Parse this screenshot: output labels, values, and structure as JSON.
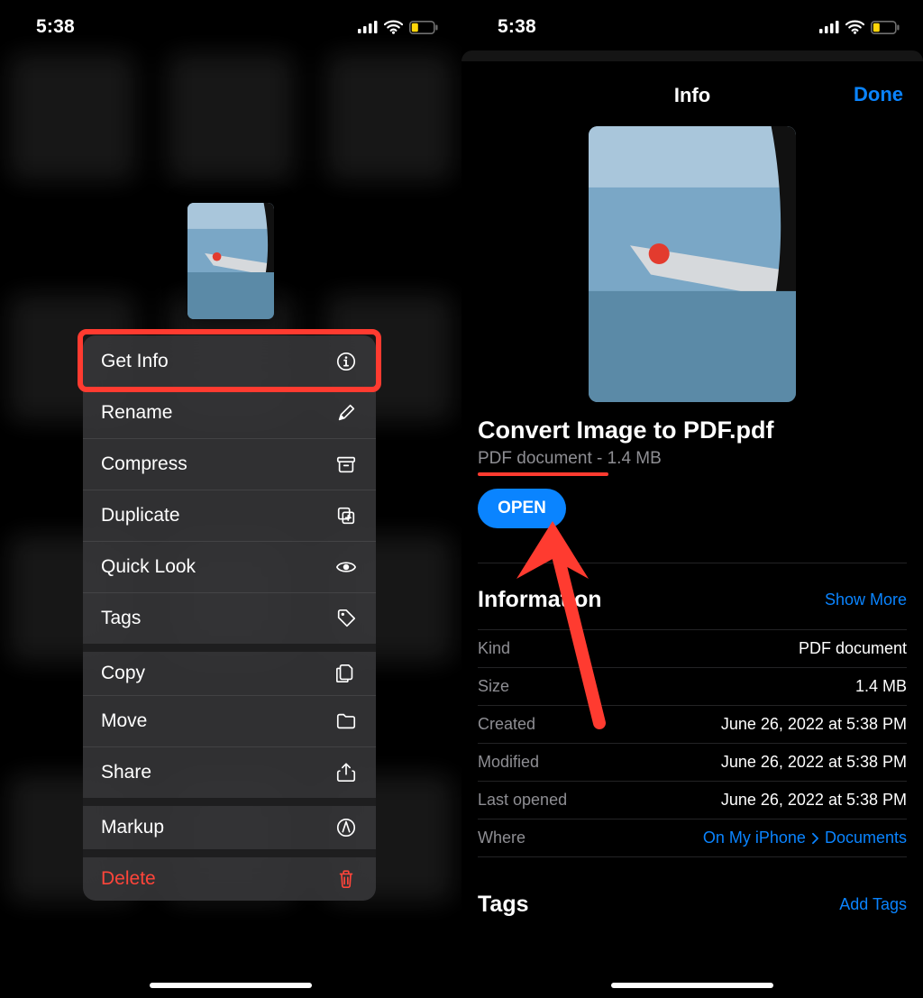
{
  "status": {
    "time": "5:38"
  },
  "contextMenu": {
    "items": [
      {
        "label": "Get Info",
        "icon": "info-icon",
        "highlight": true
      },
      {
        "label": "Rename",
        "icon": "pencil-icon"
      },
      {
        "label": "Compress",
        "icon": "archivebox-icon"
      },
      {
        "label": "Duplicate",
        "icon": "duplicate-icon"
      },
      {
        "label": "Quick Look",
        "icon": "eye-icon"
      },
      {
        "label": "Tags",
        "icon": "tag-icon"
      },
      {
        "label": "Copy",
        "icon": "copydoc-icon",
        "sepBig": true
      },
      {
        "label": "Move",
        "icon": "folder-icon"
      },
      {
        "label": "Share",
        "icon": "share-icon"
      },
      {
        "label": "Markup",
        "icon": "markup-icon",
        "sepBig": true
      },
      {
        "label": "Delete",
        "icon": "trash-icon",
        "destructive": true,
        "sepBig": true
      }
    ]
  },
  "infoSheet": {
    "title": "Info",
    "done": "Done",
    "file_title": "Convert Image to PDF.pdf",
    "file_sub": "PDF document - 1.4 MB",
    "open_label": "OPEN",
    "info_header": "Information",
    "show_more": "Show More",
    "rows": [
      {
        "k": "Kind",
        "v": "PDF document"
      },
      {
        "k": "Size",
        "v": "1.4 MB"
      },
      {
        "k": "Created",
        "v": "June 26, 2022 at 5:38 PM"
      },
      {
        "k": "Modified",
        "v": "June 26, 2022 at 5:38 PM"
      },
      {
        "k": "Last opened",
        "v": "June 26, 2022 at 5:38 PM"
      }
    ],
    "where_k": "Where",
    "where_v1": "On My iPhone",
    "where_v2": "Documents",
    "tags_header": "Tags",
    "add_tags": "Add Tags"
  }
}
